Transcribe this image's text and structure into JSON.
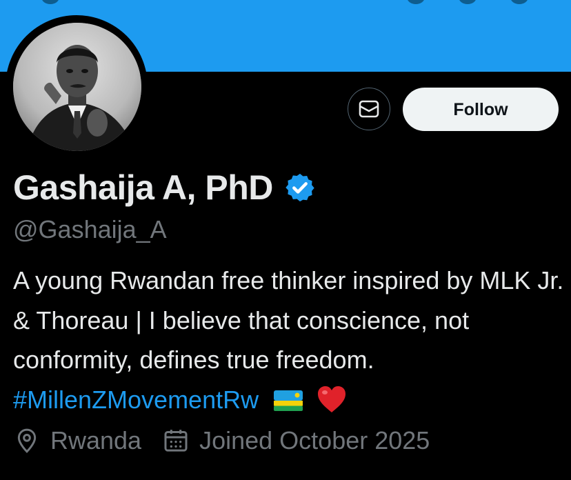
{
  "banner": {
    "color": "#1d9bf0"
  },
  "profile": {
    "name": "Gashaija A, PhD",
    "handle": "@Gashaija_A",
    "verified": true,
    "avatar": "black-and-white-portrait-avatar"
  },
  "actions": {
    "message_icon": "envelope-icon",
    "follow_label": "Follow"
  },
  "bio": {
    "text": "A young Rwandan free thinker inspired by MLK Jr. & Thoreau | I believe that conscience, not conformity, defines true freedom.",
    "hashtag": "#MillenZMovementRw",
    "emojis": [
      "rwanda-flag",
      "red-heart"
    ]
  },
  "meta": {
    "location": "Rwanda",
    "joined": "Joined October 2025"
  },
  "colors": {
    "accent": "#1d9bf0",
    "muted": "#71767b",
    "text": "#e7e9ea"
  }
}
